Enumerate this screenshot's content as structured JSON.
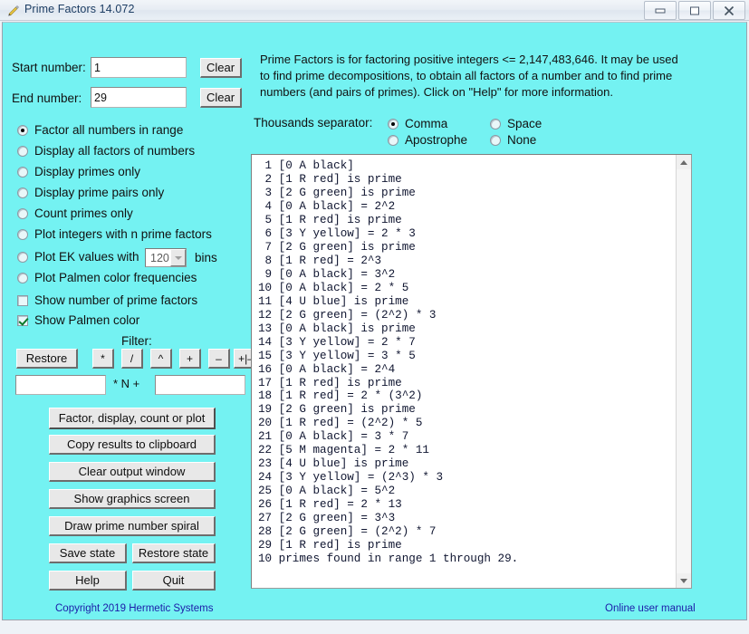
{
  "window": {
    "title": "Prime Factors 14.072",
    "icon": "pencil-icon",
    "controls": {
      "minimize": "–",
      "maximize": "□",
      "close": "✕"
    },
    "client_bg": "#74f2f2"
  },
  "inputs": {
    "start_label": "Start number:",
    "start_value": "1",
    "end_label": "End number:",
    "end_value": "29",
    "clear_start_label": "Clear",
    "clear_end_label": "Clear"
  },
  "description": {
    "line1": "Prime Factors is for factoring positive integers <= 2,147,483,646.  It may be used",
    "line2": "to find prime decompositions, to obtain all factors of a number and to find prime",
    "line3": "numbers (and pairs of primes).  Click on \"Help\" for more information."
  },
  "separator": {
    "label": "Thousands separator:",
    "options": [
      {
        "label": "Comma",
        "selected": true
      },
      {
        "label": "Space",
        "selected": false
      },
      {
        "label": "Apostrophe",
        "selected": false
      },
      {
        "label": "None",
        "selected": false
      }
    ]
  },
  "modes": [
    {
      "label": "Factor all numbers in range",
      "selected": true
    },
    {
      "label": "Display all factors of numbers",
      "selected": false
    },
    {
      "label": "Display primes only",
      "selected": false
    },
    {
      "label": "Display prime pairs only",
      "selected": false
    },
    {
      "label": "Count primes only",
      "selected": false
    },
    {
      "label": "Plot integers with n  prime factors",
      "selected": false
    },
    {
      "label": "Plot EK values with",
      "selected": false
    },
    {
      "label": "Plot Palmen color frequencies",
      "selected": false
    }
  ],
  "bins": {
    "value": "120",
    "suffix_label": "bins"
  },
  "checkboxes": [
    {
      "label": "Show number of prime factors",
      "checked": false
    },
    {
      "label": "Show Palmen color",
      "checked": true
    }
  ],
  "filter": {
    "title": "Filter:",
    "restore_label": "Restore",
    "ops": [
      "*",
      "/",
      "^",
      "+",
      "–",
      "+|–"
    ],
    "left_value": "",
    "mid_label": "* N   +",
    "right_value": ""
  },
  "actions": [
    "Factor, display, count or plot",
    "Copy results to clipboard",
    "Clear output window",
    "Show graphics screen",
    "Draw prime number spiral"
  ],
  "action_pairs": [
    [
      "Save state",
      "Restore state"
    ],
    [
      "Help",
      "Quit"
    ]
  ],
  "output": {
    "lines": [
      " 1 [0 A black]",
      " 2 [1 R red] is prime",
      " 3 [2 G green] is prime",
      " 4 [0 A black] = 2^2",
      " 5 [1 R red] is prime",
      " 6 [3 Y yellow] = 2 * 3",
      " 7 [2 G green] is prime",
      " 8 [1 R red] = 2^3",
      " 9 [0 A black] = 3^2",
      "10 [0 A black] = 2 * 5",
      "11 [4 U blue] is prime",
      "12 [2 G green] = (2^2) * 3",
      "13 [0 A black] is prime",
      "14 [3 Y yellow] = 2 * 7",
      "15 [3 Y yellow] = 3 * 5",
      "16 [0 A black] = 2^4",
      "17 [1 R red] is prime",
      "18 [1 R red] = 2 * (3^2)",
      "19 [2 G green] is prime",
      "20 [1 R red] = (2^2) * 5",
      "21 [0 A black] = 3 * 7",
      "22 [5 M magenta] = 2 * 11",
      "23 [4 U blue] is prime",
      "24 [3 Y yellow] = (2^3) * 3",
      "25 [0 A black] = 5^2",
      "26 [1 R red] = 2 * 13",
      "27 [2 G green] = 3^3",
      "28 [2 G green] = (2^2) * 7",
      "29 [1 R red] is prime",
      "10 primes found in range 1 through 29."
    ]
  },
  "footer": {
    "copyright": "Copyright 2019 Hermetic Systems",
    "manual_link": "Online user manual"
  }
}
